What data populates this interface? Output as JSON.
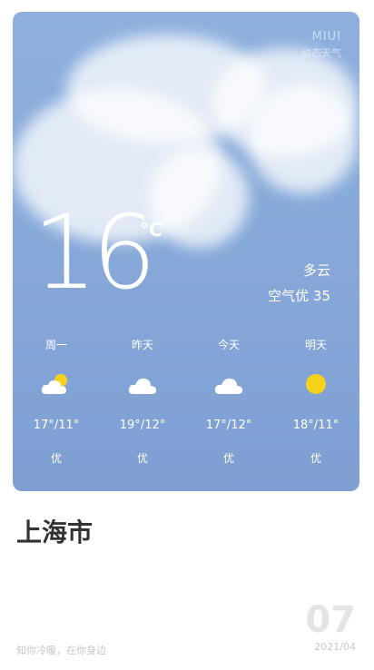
{
  "brand": {
    "line1": "MIUI",
    "line2": "动态天气"
  },
  "current": {
    "temperature": "16",
    "unit": "°C",
    "condition": "多云",
    "air_quality": "空气优 35"
  },
  "forecast": [
    {
      "day": "周一",
      "icon": "partly-cloudy-sun-icon",
      "range": "17°/11°",
      "aq": "优"
    },
    {
      "day": "昨天",
      "icon": "cloud-icon",
      "range": "19°/12°",
      "aq": "优"
    },
    {
      "day": "今天",
      "icon": "cloud-icon",
      "range": "17°/12°",
      "aq": "优"
    },
    {
      "day": "明天",
      "icon": "sun-icon",
      "range": "18°/11°",
      "aq": "优"
    }
  ],
  "city": "上海市",
  "slogan": "知你冷暖，在你身边",
  "date": {
    "day": "07",
    "year_month": "2021/04"
  },
  "colors": {
    "sun": "#f7d21a",
    "cloud": "#ffffff",
    "sky": "#87a9d9"
  }
}
